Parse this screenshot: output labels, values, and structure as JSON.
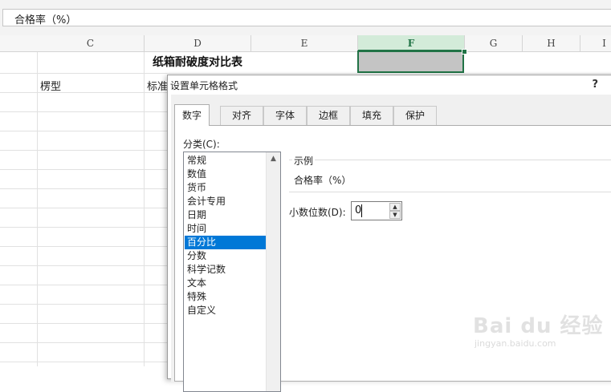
{
  "formula_bar": {
    "value": "合格率（%）"
  },
  "columns": [
    {
      "letter": "C"
    },
    {
      "letter": "D"
    },
    {
      "letter": "E"
    },
    {
      "letter": "F",
      "selected": true
    },
    {
      "letter": "G"
    },
    {
      "letter": "H"
    },
    {
      "letter": "I"
    }
  ],
  "sheet": {
    "title": "纸箱耐破度对比表",
    "cells": {
      "c_header": "楞型",
      "d_header": "标准"
    }
  },
  "dialog": {
    "title": "设置单元格格式",
    "help": "?",
    "tabs": [
      {
        "label": "数字",
        "active": true
      },
      {
        "label": "对齐"
      },
      {
        "label": "字体"
      },
      {
        "label": "边框"
      },
      {
        "label": "填充"
      },
      {
        "label": "保护"
      }
    ],
    "category_label": "分类(C):",
    "categories": [
      "常规",
      "数值",
      "货币",
      "会计专用",
      "日期",
      "时间",
      "百分比",
      "分数",
      "科学记数",
      "文本",
      "特殊",
      "自定义"
    ],
    "selected_category": "百分比",
    "sample": {
      "legend": "示例",
      "value": "合格率（%）"
    },
    "decimal_places": {
      "label": "小数位数(D):",
      "value": "0"
    }
  },
  "watermark": {
    "brand": "Bai du 经验",
    "url": "jingyan.baidu.com"
  },
  "colors": {
    "excel_green": "#217346",
    "selection_blue": "#0078d7"
  }
}
